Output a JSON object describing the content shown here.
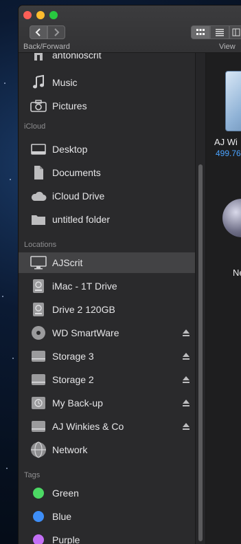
{
  "window": {
    "nav_caption": "Back/Forward",
    "view_caption": "View"
  },
  "sidebar": {
    "top_items": [
      {
        "label": "antonioscrit",
        "icon": "home-icon"
      },
      {
        "label": "Music",
        "icon": "music-icon"
      },
      {
        "label": "Pictures",
        "icon": "camera-icon"
      }
    ],
    "icloud": {
      "title": "iCloud",
      "items": [
        {
          "label": "Desktop",
          "icon": "desktop-folder-icon"
        },
        {
          "label": "Documents",
          "icon": "document-icon"
        },
        {
          "label": "iCloud Drive",
          "icon": "cloud-icon"
        },
        {
          "label": "untitled folder",
          "icon": "folder-icon"
        }
      ]
    },
    "locations": {
      "title": "Locations",
      "items": [
        {
          "label": "AJScrit",
          "icon": "imac-icon",
          "selected": true
        },
        {
          "label": "iMac - 1T Drive",
          "icon": "internal-drive-icon"
        },
        {
          "label": "Drive 2 120GB",
          "icon": "internal-drive-icon"
        },
        {
          "label": "WD SmartWare",
          "icon": "disc-icon",
          "eject": true
        },
        {
          "label": "Storage 3",
          "icon": "external-drive-icon",
          "eject": true
        },
        {
          "label": "Storage 2",
          "icon": "external-drive-icon",
          "eject": true
        },
        {
          "label": "My Back-up",
          "icon": "time-machine-drive-icon",
          "eject": true
        },
        {
          "label": "AJ Winkies & Co",
          "icon": "external-drive-icon",
          "eject": true
        },
        {
          "label": "Network",
          "icon": "network-globe-icon"
        }
      ]
    },
    "tags": {
      "title": "Tags",
      "items": [
        {
          "label": "Green",
          "color": "#4cd964"
        },
        {
          "label": "Blue",
          "color": "#3e8ef7"
        },
        {
          "label": "Purple",
          "color": "#c36ff5"
        }
      ]
    }
  },
  "content": {
    "items": [
      {
        "name": "AJ Wi",
        "size": "499.76",
        "icon": "app-icon"
      },
      {
        "name": "Ne",
        "icon": "network-icon"
      }
    ]
  }
}
